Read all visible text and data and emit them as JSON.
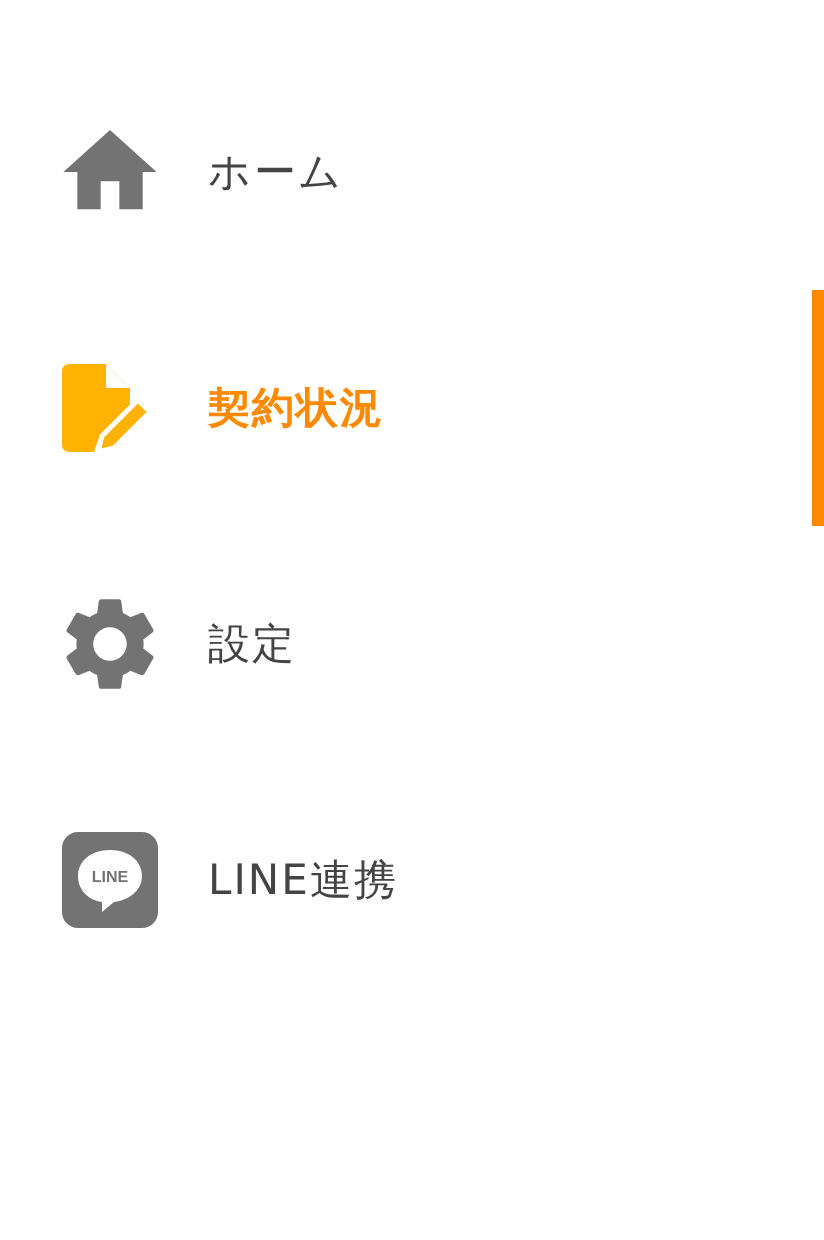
{
  "menu": {
    "items": [
      {
        "kind": "home",
        "label": "ホーム",
        "selected": false
      },
      {
        "kind": "contract",
        "label": "契約状況",
        "selected": true
      },
      {
        "kind": "settings",
        "label": "設定",
        "selected": false
      },
      {
        "kind": "line",
        "label": "LINE連携",
        "logo_text": "LINE",
        "selected": false
      }
    ]
  }
}
